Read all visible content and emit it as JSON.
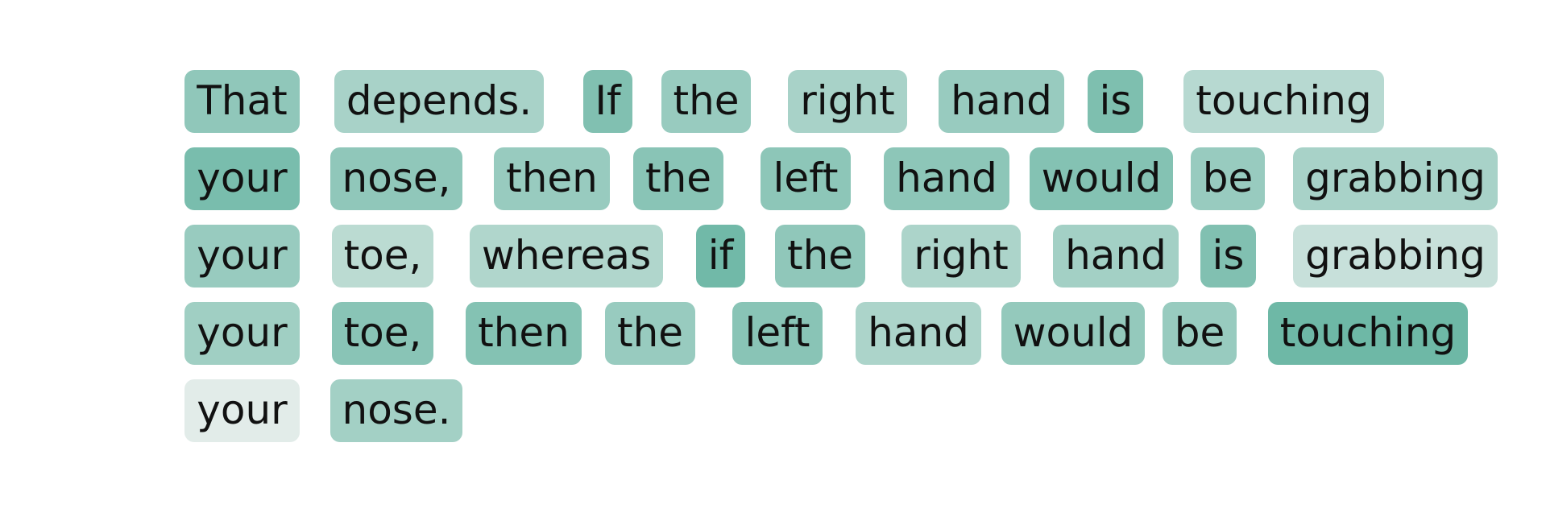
{
  "tokens": [
    [
      {
        "text": "That",
        "weight": 0.6
      },
      {
        "text": "depends.",
        "weight": 0.45
      },
      {
        "text": "If",
        "weight": 0.7
      },
      {
        "text": "the",
        "weight": 0.55
      },
      {
        "text": "right",
        "weight": 0.45
      },
      {
        "text": "hand",
        "weight": 0.55
      },
      {
        "text": "is",
        "weight": 0.72
      },
      {
        "text": "touching",
        "weight": 0.35
      }
    ],
    [
      {
        "text": "your",
        "weight": 0.75
      },
      {
        "text": "nose,",
        "weight": 0.6
      },
      {
        "text": "then",
        "weight": 0.55
      },
      {
        "text": "the",
        "weight": 0.65
      },
      {
        "text": "left",
        "weight": 0.62
      },
      {
        "text": "hand",
        "weight": 0.62
      },
      {
        "text": "would",
        "weight": 0.68
      },
      {
        "text": "be",
        "weight": 0.55
      },
      {
        "text": "grabbing",
        "weight": 0.45
      }
    ],
    [
      {
        "text": "your",
        "weight": 0.55
      },
      {
        "text": "toe,",
        "weight": 0.33
      },
      {
        "text": "whereas",
        "weight": 0.4
      },
      {
        "text": "if",
        "weight": 0.8
      },
      {
        "text": "the",
        "weight": 0.6
      },
      {
        "text": "right",
        "weight": 0.42
      },
      {
        "text": "hand",
        "weight": 0.48
      },
      {
        "text": "is",
        "weight": 0.7
      },
      {
        "text": "grabbing",
        "weight": 0.25
      }
    ],
    [
      {
        "text": "your",
        "weight": 0.5
      },
      {
        "text": "toe,",
        "weight": 0.65
      },
      {
        "text": "then",
        "weight": 0.68
      },
      {
        "text": "the",
        "weight": 0.55
      },
      {
        "text": "left",
        "weight": 0.65
      },
      {
        "text": "hand",
        "weight": 0.42
      },
      {
        "text": "would",
        "weight": 0.58
      },
      {
        "text": "be",
        "weight": 0.55
      },
      {
        "text": "touching",
        "weight": 0.82
      }
    ],
    [
      {
        "text": "your",
        "weight": 0.08
      },
      {
        "text": "nose.",
        "weight": 0.48
      }
    ]
  ],
  "colors": {
    "low": "#eef2f0",
    "high": "#52ab96",
    "text": "#111111"
  }
}
